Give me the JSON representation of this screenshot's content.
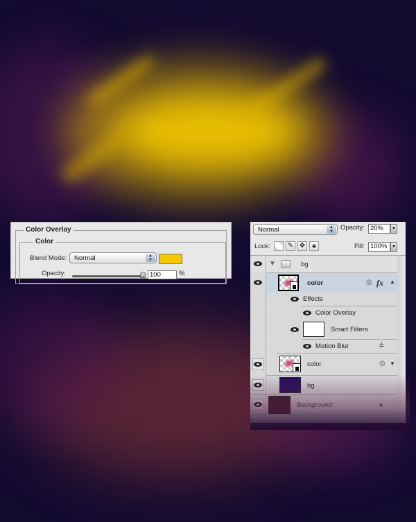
{
  "color_overlay_dialog": {
    "title": "Color Overlay",
    "section": "Color",
    "blend_mode_label": "Blend Mode:",
    "blend_mode_value": "Normal",
    "overlay_color": "#f5c800",
    "opacity_label": "Opacity:",
    "opacity_value": "100",
    "opacity_unit": "%",
    "opacity_slider_fraction": 1.0
  },
  "layers_panel": {
    "blend_mode": "Normal",
    "opacity_label": "Opacity:",
    "opacity_value": "20%",
    "lock_label": "Lock:",
    "fill_label": "Fill:",
    "fill_value": "100%",
    "lock_icons": [
      "lock-transparent-pixels-icon",
      "lock-image-pixels-icon",
      "lock-position-icon",
      "lock-all-icon"
    ],
    "layers": [
      {
        "name": "bg",
        "type": "group",
        "expanded": true,
        "visible": true
      },
      {
        "name": "color",
        "type": "smart-object",
        "selected": true,
        "visible": true,
        "has_fx": true
      },
      {
        "name": "Effects",
        "type": "effects-header",
        "visible": true
      },
      {
        "name": "Color Overlay",
        "type": "effect",
        "visible": true
      },
      {
        "name": "Smart Filters",
        "type": "smart-filters",
        "visible": true
      },
      {
        "name": "Motion Blur",
        "type": "filter",
        "visible": true
      },
      {
        "name": "color",
        "type": "smart-object",
        "visible": true
      },
      {
        "name": "bg",
        "type": "fill",
        "visible": true,
        "swatch": "#2a0f5e"
      },
      {
        "name": "Background",
        "type": "background",
        "visible": true,
        "locked": true,
        "swatch": "#3a1c22"
      }
    ],
    "fx_label": "fx"
  }
}
